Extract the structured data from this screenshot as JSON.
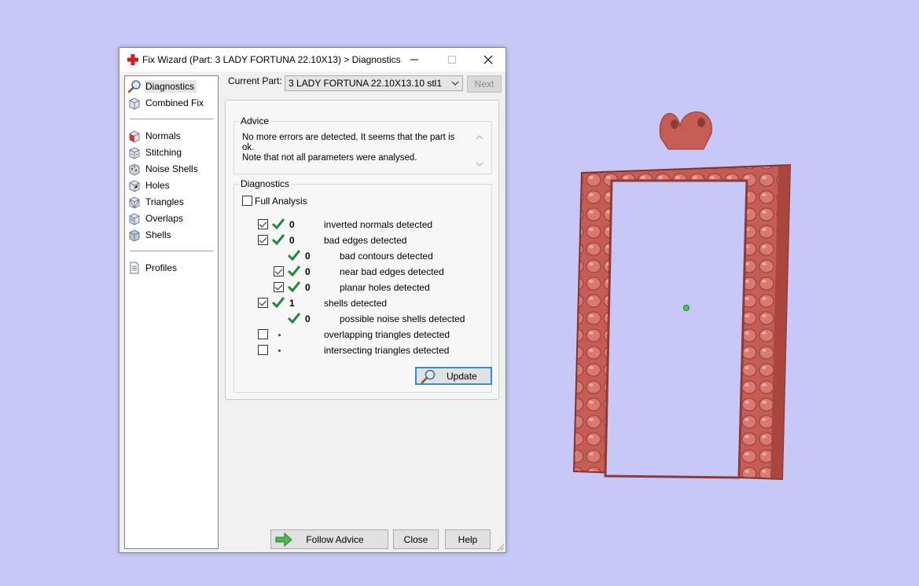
{
  "window": {
    "title": "Fix Wizard (Part: 3 LADY FORTUNA 22.10X13) > Diagnostics"
  },
  "sidebar": {
    "items": [
      {
        "label": "Diagnostics",
        "icon": "magnifier-icon",
        "selected": true
      },
      {
        "label": "Combined Fix",
        "icon": "cube-icon"
      },
      {
        "label": "Normals",
        "icon": "normals-cube-icon"
      },
      {
        "label": "Stitching",
        "icon": "stitching-cube-icon"
      },
      {
        "label": "Noise Shells",
        "icon": "noise-shells-icon"
      },
      {
        "label": "Holes",
        "icon": "holes-cube-icon"
      },
      {
        "label": "Triangles",
        "icon": "triangles-cube-icon"
      },
      {
        "label": "Overlaps",
        "icon": "overlaps-cube-icon"
      },
      {
        "label": "Shells",
        "icon": "shells-cube-icon"
      },
      {
        "label": "Profiles",
        "icon": "document-icon"
      }
    ]
  },
  "top": {
    "current_part_label": "Current Part:",
    "current_part_value": "3 LADY FORTUNA 22.10X13.10 stl1",
    "next_label": "Next"
  },
  "advice": {
    "title": "Advice",
    "line1": "No more errors are detected. It seems that the part is ok.",
    "line2": "Note that not all parameters were analysed."
  },
  "diagnostics": {
    "title": "Diagnostics",
    "full_analysis_label": "Full Analysis",
    "full_analysis_checked": false,
    "rows": [
      {
        "checked": true,
        "status": "ok",
        "count": "0",
        "label": "inverted normals detected"
      },
      {
        "checked": true,
        "status": "ok",
        "count": "0",
        "label": "bad edges detected"
      },
      {
        "checked": null,
        "status": "ok",
        "count": "0",
        "label": "bad contours detected"
      },
      {
        "checked": true,
        "status": "ok",
        "count": "0",
        "label": "near bad edges detected"
      },
      {
        "checked": true,
        "status": "ok",
        "count": "0",
        "label": "planar holes detected"
      },
      {
        "checked": true,
        "status": "ok",
        "count": "1",
        "label": "shells detected"
      },
      {
        "checked": null,
        "status": "ok",
        "count": "0",
        "label": "possible noise shells detected"
      },
      {
        "checked": false,
        "status": "pending",
        "count": "",
        "label": "overlapping triangles detected"
      },
      {
        "checked": false,
        "status": "pending",
        "count": "",
        "label": "intersecting triangles detected"
      }
    ],
    "update_label": "Update"
  },
  "buttons": {
    "follow_advice": "Follow Advice",
    "close": "Close",
    "help": "Help"
  },
  "colors": {
    "background": "#c8c8f8",
    "model": "#c9625c",
    "check_green": "#1f8a3a",
    "focus_blue": "#2d8fd6"
  }
}
